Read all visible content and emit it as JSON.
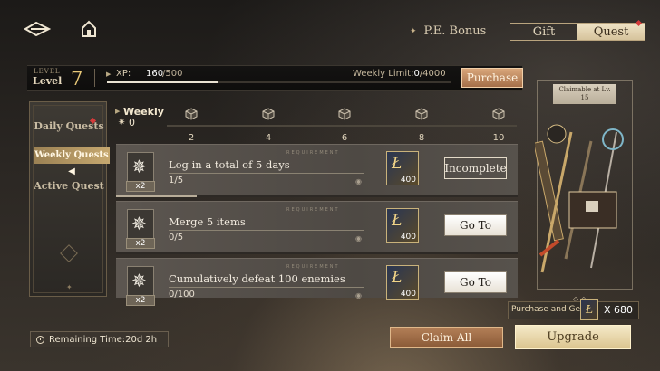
{
  "nav": {
    "pe_bonus_label": "P.E. Bonus",
    "tabs": [
      {
        "label": "Gift",
        "active": false
      },
      {
        "label": "Quest",
        "active": true
      }
    ]
  },
  "level": {
    "small_label": "LEVEL",
    "label": "Level",
    "value": "7",
    "xp_label": "XP:",
    "xp_current": "160",
    "xp_max": "/500",
    "xp_progress": 0.32,
    "weekly_limit_label": "Weekly Limit:",
    "weekly_limit_current": "0",
    "weekly_limit_max": "/4000",
    "purchase_label": "Purchase"
  },
  "sidebar": {
    "items": [
      {
        "label": "Daily Quests",
        "selected": false,
        "badge": true
      },
      {
        "label": "Weekly Quests",
        "selected": true,
        "badge": false
      },
      {
        "label": "Active Quest",
        "selected": false,
        "badge": false
      }
    ]
  },
  "weekly_progress": {
    "title": "Weekly",
    "count": "0",
    "milestones": [
      "2",
      "4",
      "6",
      "8",
      "10"
    ]
  },
  "quests": [
    {
      "title": "Log in a total of 5 days",
      "requirement_label": "REQUIREMENT",
      "progress_text": "1/5",
      "progress": 0.2,
      "multiplier": "x2",
      "reward_amount": "400",
      "action_label": "Incomplete",
      "action_style": "incomplete"
    },
    {
      "title": "Merge 5 items",
      "requirement_label": "REQUIREMENT",
      "progress_text": "0/5",
      "progress": 0,
      "multiplier": "x2",
      "reward_amount": "400",
      "action_label": "Go To",
      "action_style": "goto"
    },
    {
      "title": "Cumulatively defeat 100 enemies",
      "requirement_label": "REQUIREMENT",
      "progress_text": "0/100",
      "progress": 0,
      "multiplier": "x2",
      "reward_amount": "400",
      "action_label": "Go To",
      "action_style": "goto"
    }
  ],
  "reward_panel": {
    "claim_tag": "Claimable at Lv.\n15",
    "purchase_get_label": "Purchase and Get",
    "purchase_get_amount": "X 680"
  },
  "footer": {
    "remaining_label": "Remaining Time:20d 2h",
    "claim_all_label": "Claim All",
    "upgrade_label": "Upgrade"
  },
  "colors": {
    "accent_gold": "#e8c878",
    "purchase_btn": "#c48c62",
    "upgrade_btn": "#e9d8aa",
    "badge_red": "#d43a3a"
  }
}
